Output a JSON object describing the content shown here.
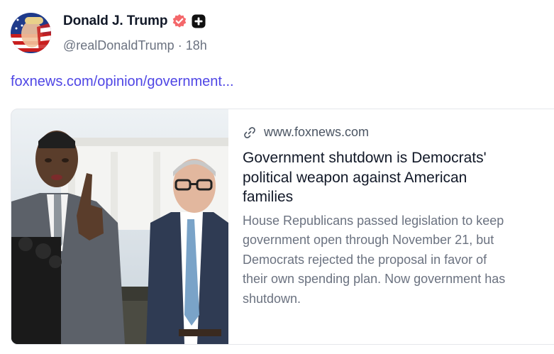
{
  "post": {
    "author": {
      "display_name": "Donald J. Trump",
      "handle": "@realDonaldTrump",
      "time_ago": "18h",
      "separator": "·",
      "verified_icon": "verified-badge-icon",
      "extra_badge_icon": "plus-badge-icon"
    },
    "link_text": "foxnews.com/opinion/government...",
    "card": {
      "domain": "www.foxnews.com",
      "title": "Government shutdown is Democrats' political weapon against American families",
      "description": "House Republicans passed legislation to keep government open through November 21, but Democrats rejected the proposal in favor of their own spending plan. Now government has shutdown.",
      "link_icon": "link-icon"
    }
  },
  "colors": {
    "verified": "#f4676a",
    "link": "#4f46e5",
    "muted": "#6b7280"
  }
}
